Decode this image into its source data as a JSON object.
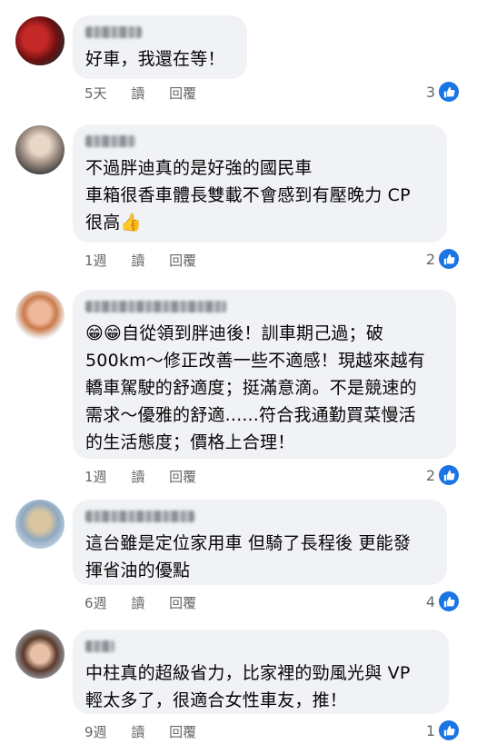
{
  "comments": [
    {
      "lines": [
        "好車，我還在等！"
      ],
      "time": "5天",
      "read": "讀",
      "reply": "回覆",
      "likes": "3"
    },
    {
      "lines": [
        "不過胖迪真的是好強的國民車",
        "車箱很香車體長雙載不會感到有壓晚力 CP",
        "很高"
      ],
      "emoji_after": "👍",
      "time": "1週",
      "read": "讀",
      "reply": "回覆",
      "likes": "2"
    },
    {
      "emoji_before": "😁😁",
      "lines": [
        "自從領到胖迪後！訓車期己過；破",
        "500km～修正改善一些不適感！現越來越有",
        "轎車駕駛的舒適度；挺滿意滴。不是競速的",
        "需求～優雅的舒適......符合我通勤買菜慢活",
        "的生活態度；價格上合理！"
      ],
      "time": "1週",
      "read": "讀",
      "reply": "回覆",
      "likes": "2"
    },
    {
      "lines": [
        "這台雖是定位家用車 但騎了長程後 更能發",
        "揮省油的優點"
      ],
      "time": "6週",
      "read": "讀",
      "reply": "回覆",
      "likes": "4"
    },
    {
      "lines": [
        "中柱真的超級省力，比家裡的勁風光與 VP",
        "輕太多了，很適合女性車友，推！"
      ],
      "time": "9週",
      "read": "讀",
      "reply": "回覆",
      "likes": "1"
    }
  ],
  "colors": {
    "bubble": "#f0f2f5",
    "meta": "#65676b",
    "like": "#1b74e4"
  }
}
